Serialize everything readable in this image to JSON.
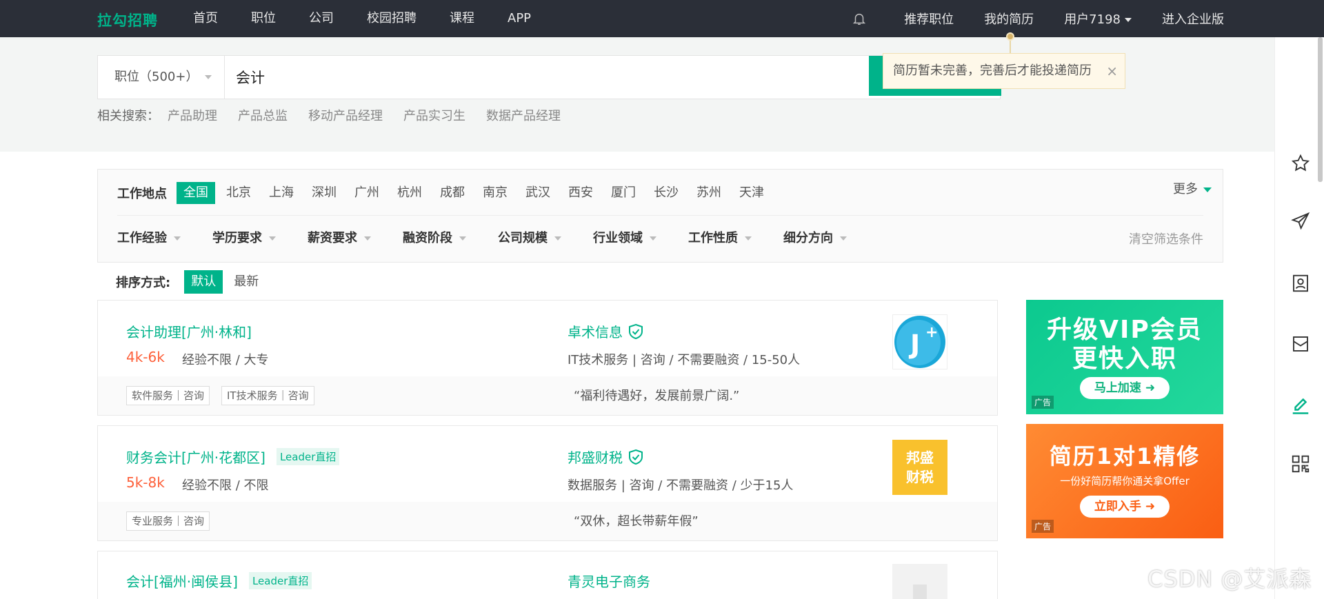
{
  "nav": {
    "logo": "拉勾招聘",
    "links": [
      "首页",
      "职位",
      "公司",
      "校园招聘",
      "课程",
      "APP"
    ],
    "recommended": "推荐职位",
    "my_resume": "我的简历",
    "user": "用户7198",
    "enterprise": "进入企业版"
  },
  "search": {
    "type_label": "职位（500+）",
    "query": "会计",
    "related_label": "相关搜索：",
    "related": [
      "产品助理",
      "产品总监",
      "移动产品经理",
      "产品实习生",
      "数据产品经理"
    ]
  },
  "tooltip": {
    "text": "简历暂未完善，完善后才能投递简历"
  },
  "filters": {
    "location_label": "工作地点",
    "cities": [
      "全国",
      "北京",
      "上海",
      "深圳",
      "广州",
      "杭州",
      "成都",
      "南京",
      "武汉",
      "西安",
      "厦门",
      "长沙",
      "苏州",
      "天津"
    ],
    "active_city": "全国",
    "more": "更多",
    "dropdowns": [
      "工作经验",
      "学历要求",
      "薪资要求",
      "融资阶段",
      "公司规模",
      "行业领域",
      "工作性质",
      "细分方向"
    ],
    "clear": "清空筛选条件"
  },
  "sort": {
    "label": "排序方式:",
    "options": [
      "默认",
      "最新"
    ],
    "active": "默认"
  },
  "jobs": [
    {
      "title": "会计助理[广州·林和]",
      "leader": "",
      "salary": "4k-6k",
      "requirements": "经验不限 / 大专",
      "company": "卓术信息",
      "company_info": "IT技术服务 | 咨询 / 不需要融资 / 15-50人",
      "tags": [
        "软件服务｜咨询",
        "IT技术服务｜咨询"
      ],
      "quote": "“福利待遇好，发展前景广阔.”"
    },
    {
      "title": "财务会计[广州·花都区]",
      "leader": "Leader直招",
      "salary": "5k-8k",
      "requirements": "经验不限 / 不限",
      "company": "邦盛财税",
      "company_info": "数据服务 | 咨询 / 不需要融资 / 少于15人",
      "logo_text": [
        "邦盛",
        "财税"
      ],
      "tags": [
        "专业服务｜咨询"
      ],
      "quote": "“双休，超长带薪年假”"
    },
    {
      "title": "会计[福州·闽侯县]",
      "leader": "Leader直招",
      "company": "青灵电子商务"
    }
  ],
  "ads": [
    {
      "line1": "升级VIP会员",
      "line2": "更快入职",
      "button": "马上加速",
      "tag": "广告"
    },
    {
      "line1": "简历1对1精修",
      "sub": "一份好简历帮你通关拿Offer",
      "button": "立即入手",
      "tag": "广告"
    }
  ],
  "watermark": "CSDN @艾派森",
  "colors": {
    "brand": "#00b38a",
    "salary": "#fd5f39",
    "nav_bg": "#2b2f38"
  }
}
